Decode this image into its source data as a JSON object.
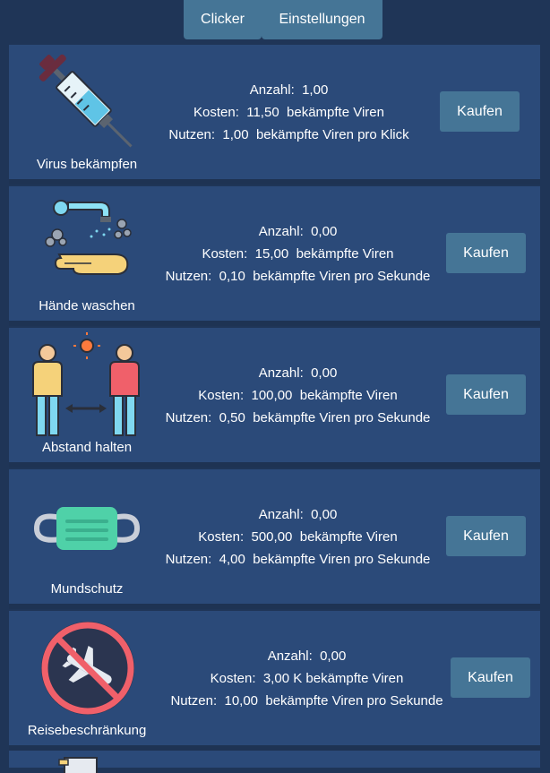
{
  "tabs": {
    "clicker": "Clicker",
    "settings": "Einstellungen"
  },
  "labels": {
    "count": "Anzahl:",
    "cost": "Kosten:",
    "benefit": "Nutzen:",
    "buy": "Kaufen"
  },
  "items": [
    {
      "name": "Virus bekämpfen",
      "icon": "syringe-icon",
      "count": "1,00",
      "cost": "11,50",
      "cost_unit": "bekämpfte Viren",
      "benefit": "1,00",
      "benefit_unit": "bekämpfte Viren pro Klick"
    },
    {
      "name": "Hände waschen",
      "icon": "hand-washing-icon",
      "count": "0,00",
      "cost": "15,00",
      "cost_unit": "bekämpfte Viren",
      "benefit": "0,10",
      "benefit_unit": "bekämpfte Viren pro Sekunde"
    },
    {
      "name": "Abstand halten",
      "icon": "social-distance-icon",
      "count": "0,00",
      "cost": "100,00",
      "cost_unit": "bekämpfte Viren",
      "benefit": "0,50",
      "benefit_unit": "bekämpfte Viren pro Sekunde"
    },
    {
      "name": "Mundschutz",
      "icon": "face-mask-icon",
      "count": "0,00",
      "cost": "500,00",
      "cost_unit": "bekämpfte Viren",
      "benefit": "4,00",
      "benefit_unit": "bekämpfte Viren pro Sekunde"
    },
    {
      "name": "Reisebeschränkung",
      "icon": "no-flights-icon",
      "count": "0,00",
      "cost": "3,00 K",
      "cost_unit": "bekämpfte Viren",
      "benefit": "10,00",
      "benefit_unit": "bekämpfte Viren pro Sekunde"
    }
  ]
}
